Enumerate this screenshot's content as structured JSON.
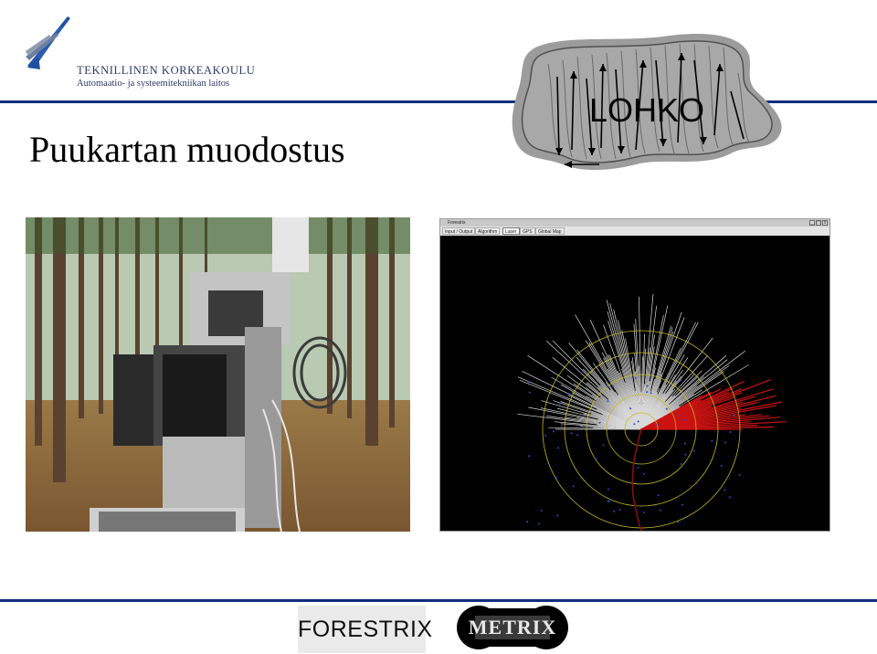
{
  "header": {
    "institution_line1": "TEKNILLINEN KORKEAKOULU",
    "institution_line2": "Automaatio- ja systeemitekniikan laitos",
    "logo_icon": "university-wing-logo"
  },
  "slide": {
    "title": "Puukartan muodostus",
    "figure_label": "LOHKO"
  },
  "app_window": {
    "title": "Forestrix",
    "tabs": [
      {
        "label": "Input / Output",
        "active": false
      },
      {
        "label": "Algorithm",
        "active": false
      },
      {
        "label": "Laser",
        "active": true
      },
      {
        "label": "GPS",
        "active": false
      },
      {
        "label": "Global Map",
        "active": false
      }
    ],
    "window_buttons": [
      "_",
      "□",
      "x"
    ]
  },
  "footer": {
    "logo1_text": "FORESTRIX",
    "logo2_text": "METRIX"
  },
  "colors": {
    "accent_rule": "#0d2f7e",
    "app_background": "#000000",
    "ring_color": "#c8b81e",
    "scan_ray_color": "#d9d9d9",
    "detected_color": "#cc1212"
  }
}
